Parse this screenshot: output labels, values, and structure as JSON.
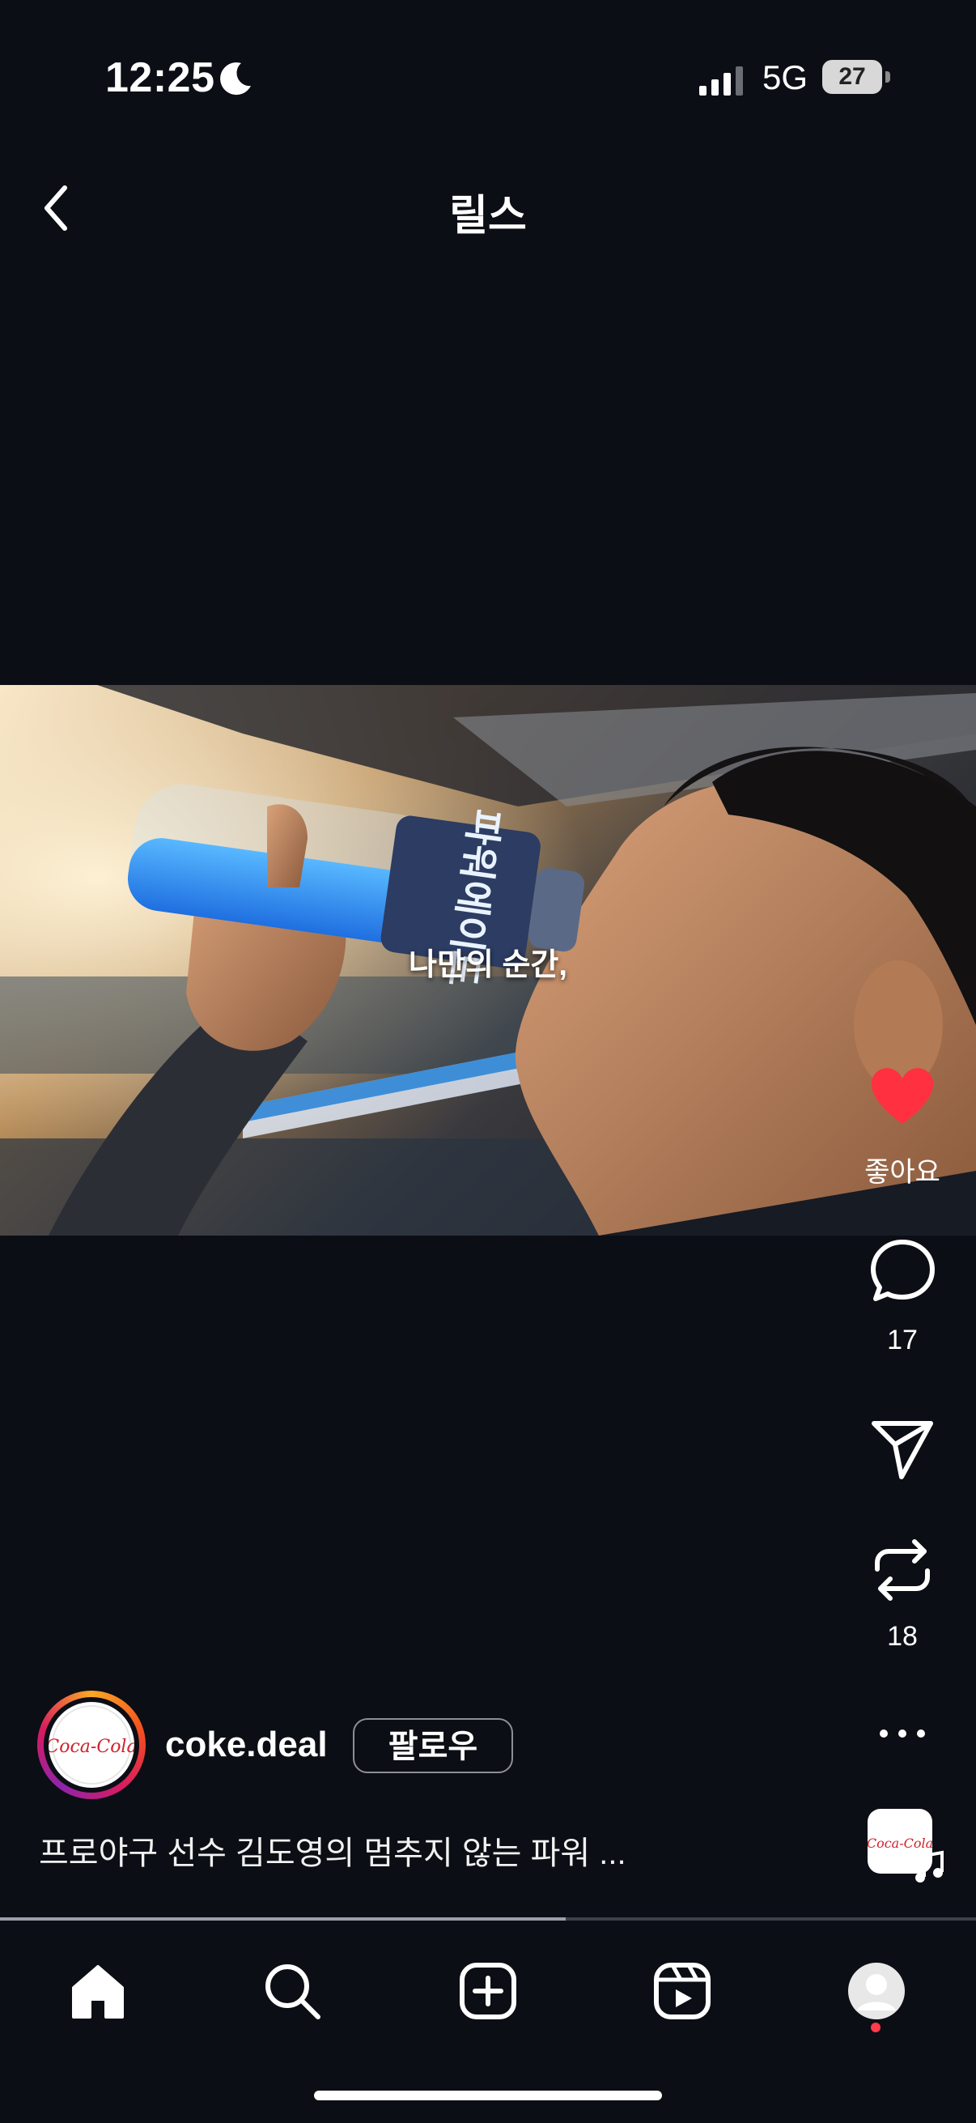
{
  "status_bar": {
    "time": "12:25",
    "network": "5G",
    "battery_level": "27",
    "icons": [
      "moon-icon",
      "signal-icon",
      "battery-icon"
    ]
  },
  "header": {
    "title": "릴스",
    "back_icon": "chevron-left-icon"
  },
  "video": {
    "caption": "나만의 순간,",
    "label_text": "파워에이드"
  },
  "actions": {
    "like_label": "좋아요",
    "comment_count": "17",
    "repost_count": "18",
    "like_color": "#ff3040"
  },
  "author": {
    "username": "coke.deal",
    "follow_label": "팔로우",
    "caption": "프로야구 선수 김도영의 멈추지 않는 파워 ...",
    "logo_text": "Coca-Cola",
    "logo_color": "#d2202a"
  },
  "playback": {
    "progress_fraction": 0.58
  },
  "tab_bar": {
    "items": [
      "home-icon",
      "search-icon",
      "create-icon",
      "reels-icon",
      "profile-icon"
    ],
    "active": "home-icon"
  }
}
